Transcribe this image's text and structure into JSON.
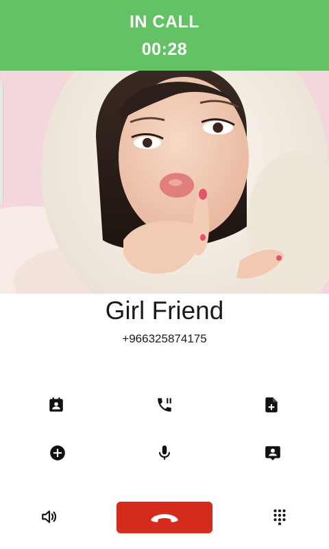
{
  "call": {
    "state": "IN CALL",
    "timer": "00:28"
  },
  "contact": {
    "name": "Girl Friend",
    "number": "+966325874175"
  },
  "controls": {
    "row1": [
      "contact-card-icon",
      "call-hold-icon",
      "add-document-icon"
    ],
    "row2": [
      "add-circle-icon",
      "microphone-icon",
      "contact-message-icon"
    ],
    "bottom": [
      "speaker-icon",
      "end-call-icon",
      "dialpad-icon"
    ]
  },
  "colors": {
    "status_bar": "#62c264",
    "end_call": "#d42b1c",
    "icon": "#111111"
  }
}
